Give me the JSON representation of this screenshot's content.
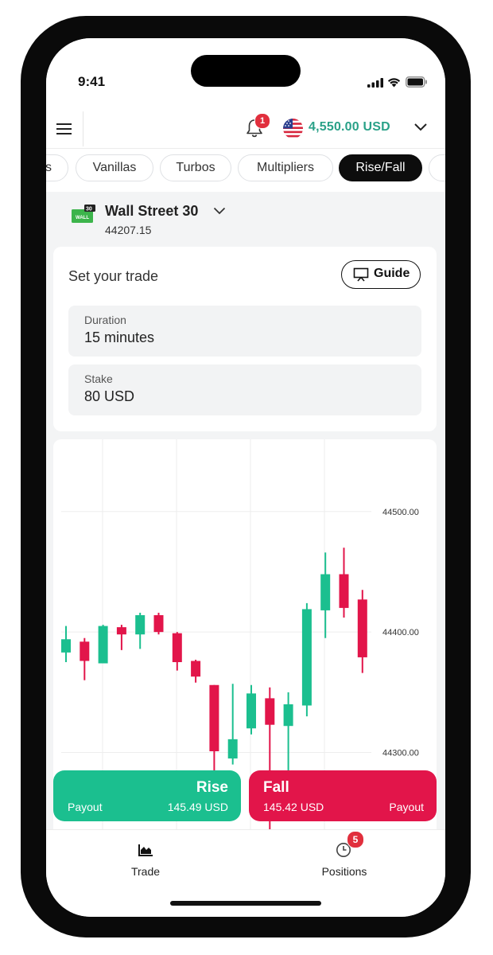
{
  "status_bar": {
    "time": "9:41"
  },
  "header": {
    "notification_count": "1",
    "balance": "4,550.00 USD",
    "brand_color": "#2aa188"
  },
  "tabs": [
    {
      "label": "s"
    },
    {
      "label": "Vanillas"
    },
    {
      "label": "Turbos"
    },
    {
      "label": "Multipliers"
    },
    {
      "label": "Rise/Fall",
      "active": true
    },
    {
      "label": ""
    }
  ],
  "symbol": {
    "name": "Wall Street 30",
    "price": "44207.15",
    "icon_text": "WALL",
    "icon_badge": "30"
  },
  "trade_form": {
    "title": "Set your trade",
    "guide_label": "Guide",
    "duration": {
      "label": "Duration",
      "value": "15 minutes"
    },
    "stake": {
      "label": "Stake",
      "value": "80 USD"
    }
  },
  "chart_data": {
    "type": "candlestick",
    "y_ticks": [
      "44500.00",
      "44400.00",
      "44300.00"
    ],
    "ylim": [
      44190,
      44560
    ],
    "grid": true,
    "candles": [
      {
        "o": 44383,
        "c": 44394,
        "h": 44405,
        "l": 44375
      },
      {
        "o": 44392,
        "c": 44376,
        "h": 44395,
        "l": 44360
      },
      {
        "o": 44374,
        "c": 44405,
        "h": 44406,
        "l": 44374
      },
      {
        "o": 44404,
        "c": 44398,
        "h": 44406,
        "l": 44385
      },
      {
        "o": 44398,
        "c": 44414,
        "h": 44416,
        "l": 44386
      },
      {
        "o": 44414,
        "c": 44400,
        "h": 44416,
        "l": 44398
      },
      {
        "o": 44399,
        "c": 44375,
        "h": 44400,
        "l": 44368
      },
      {
        "o": 44376,
        "c": 44363,
        "h": 44377,
        "l": 44358
      },
      {
        "o": 44356,
        "c": 44301,
        "h": 44356,
        "l": 44285
      },
      {
        "o": 44295,
        "c": 44311,
        "h": 44357,
        "l": 44290
      },
      {
        "o": 44320,
        "c": 44349,
        "h": 44356,
        "l": 44315
      },
      {
        "o": 44345,
        "c": 44323,
        "h": 44354,
        "l": 44200
      },
      {
        "o": 44322,
        "c": 44340,
        "h": 44350,
        "l": 44243
      },
      {
        "o": 44339,
        "c": 44419,
        "h": 44424,
        "l": 44330
      },
      {
        "o": 44418,
        "c": 44448,
        "h": 44466,
        "l": 44395
      },
      {
        "o": 44448,
        "c": 44420,
        "h": 44470,
        "l": 44412
      },
      {
        "o": 44427,
        "c": 44379,
        "h": 44435,
        "l": 44366
      }
    ],
    "up_color": "#1bbf8f",
    "down_color": "#e2154a"
  },
  "actions": {
    "rise": {
      "label": "Rise",
      "payout_label": "Payout",
      "payout": "145.49 USD",
      "color": "#1bbf8f"
    },
    "fall": {
      "label": "Fall",
      "payout_label": "Payout",
      "payout": "145.42 USD",
      "color": "#e2154a"
    }
  },
  "bottom_nav": {
    "trade_label": "Trade",
    "positions_label": "Positions",
    "positions_count": "5"
  }
}
